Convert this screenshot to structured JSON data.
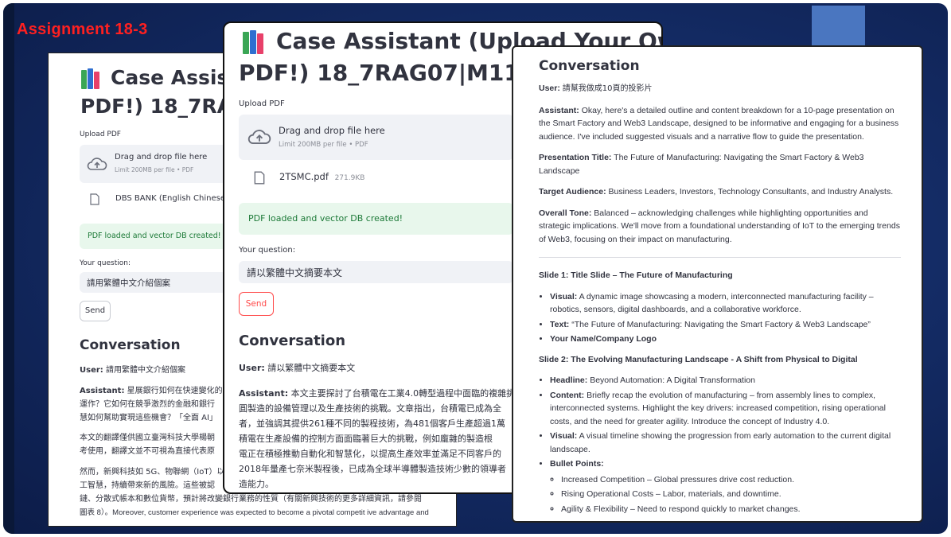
{
  "slide": {
    "tag": "Assignment 18-3"
  },
  "window1": {
    "title": "Case Assist",
    "title_line2": "PDF!) 18_7RAG",
    "upload_label": "Upload PDF",
    "drop_main": "Drag and drop file here",
    "drop_sub": "Limit 200MB per file • PDF",
    "file_name": "DBS BANK (English Chinese Tra",
    "success": "PDF loaded and vector DB created!",
    "question_label": "Your question:",
    "question_value": "請用繁體中文介紹個案",
    "send_label": "Send",
    "conversation_heading": "Conversation",
    "user_prefix": "User:",
    "user_text": "請用繁體中文介紹個案",
    "assistant_prefix": "Assistant:",
    "assistant_lines": [
      "星展銀行如何在快速變化的銀",
      "運作？它如何在競爭激烈的金融和銀行",
      "慧如何幫助實現這些機會？「全面 AI」"
    ],
    "para2_lines": [
      "本文的翻譯僅供國立臺灣科技大學楊朝",
      "考使用，翻譯文並不可視為直接代表原"
    ],
    "para3_lines": [
      "然而，新興科技如 5G、物聯網（IoT）以",
      "工智慧，持續帶來新的風險。這些被認",
      "鏈、分散式帳本和數位貨幣，預計將改變銀行業務的性質（有關新興技術的更多詳細資訊，請參閱",
      "圖表 8）。Moreover, customer experience was expected to become a pivotal competit ive advantage and"
    ]
  },
  "window2": {
    "title": "Case Assistant (Upload Your Own",
    "title_line2": "PDF!) 18_7RAG07|M1130",
    "upload_label": "Upload PDF",
    "drop_main": "Drag and drop file here",
    "drop_sub": "Limit 200MB per file • PDF",
    "file_name": "2TSMC.pdf",
    "file_size": "271.9KB",
    "success": "PDF loaded and vector DB created!",
    "question_label": "Your question:",
    "question_value": "請以繁體中文摘要本文",
    "send_label": "Send",
    "conversation_heading": "Conversation",
    "user_prefix": "User:",
    "user_text": "請以繁體中文摘要本文",
    "assistant_prefix": "Assistant:",
    "assistant_first": "本文主要探討了台積電在工業4.0轉型過程中面臨的複雜挑",
    "assistant_lines": [
      "圓製造的設備管理以及生產技術的挑戰。文章指出，台積電已成為全",
      "者，並強調其提供261種不同的製程技術，為481個客戶生產超過1萬",
      "積電在生產設備的控制方面面臨著巨大的挑戰，例如龐雜的製造根",
      "電正在積極推動自動化和智慧化，以提高生產效率並滿足不同客戶的",
      "2018年量產七奈米製程後，已成為全球半導體製造技術少數的領導者",
      "造能力。"
    ]
  },
  "window3": {
    "heading": "Conversation",
    "user_prefix": "User:",
    "user_text": "請幫我做成10頁的投影片",
    "assistant_prefix": "Assistant:",
    "assistant_text": "Okay, here's a detailed outline and content breakdown for a 10-page presentation on the Smart Factory and Web3 Landscape, designed to be informative and engaging for a business audience. I've included suggested visuals and a narrative flow to guide the presentation.",
    "pres_title_label": "Presentation Title:",
    "pres_title_value": "The Future of Manufacturing: Navigating the Smart Factory & Web3 Landscape",
    "audience_label": "Target Audience:",
    "audience_value": "Business Leaders, Investors, Technology Consultants, and Industry Analysts.",
    "tone_label": "Overall Tone:",
    "tone_value": "Balanced – acknowledging challenges while highlighting opportunities and strategic implications. We'll move from a foundational understanding of IoT to the emerging trends of Web3, focusing on their impact on manufacturing.",
    "slide1_heading": "Slide 1: Title Slide – The Future of Manufacturing",
    "slide1_bullets": [
      {
        "label": "Visual:",
        "text": "A dynamic image showcasing a modern, interconnected manufacturing facility – robotics, sensors, digital dashboards, and a collaborative workforce."
      },
      {
        "label": "Text:",
        "text": "“The Future of Manufacturing: Navigating the Smart Factory & Web3 Landscape”"
      },
      {
        "label": "Your Name/Company Logo",
        "text": ""
      }
    ],
    "slide2_heading": "Slide 2: The Evolving Manufacturing Landscape - A Shift from Physical to Digital",
    "slide2_bullets": [
      {
        "label": "Headline:",
        "text": "Beyond Automation: A Digital Transformation"
      },
      {
        "label": "Content:",
        "text": "Briefly recap the evolution of manufacturing – from assembly lines to complex, interconnected systems. Highlight the key drivers: increased competition, rising operational costs, and the need for greater agility. Introduce the concept of Industry 4.0."
      },
      {
        "label": "Visual:",
        "text": "A visual timeline showing the progression from early automation to the current digital landscape."
      },
      {
        "label": "Bullet Points:",
        "text": ""
      }
    ],
    "sub_bullets": [
      "Increased Competition – Global pressures drive cost reduction.",
      "Rising Operational Costs – Labor, materials, and downtime.",
      "Agility & Flexibility – Need to respond quickly to market changes."
    ]
  }
}
